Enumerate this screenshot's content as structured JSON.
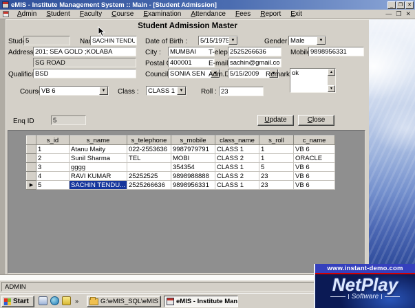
{
  "window": {
    "title": "eMIS - Institute Management System :: Main - [Student Admission]",
    "controls": {
      "minimize": "_",
      "restore": "❐",
      "close": "✕"
    },
    "mdi_controls": {
      "minimize": "—",
      "restore": "❐",
      "close": "✕"
    }
  },
  "menu": {
    "items": [
      "Admin",
      "Student",
      "Faculty",
      "Course",
      "Examination",
      "Attendance",
      "Fees",
      "Report",
      "Exit"
    ]
  },
  "form": {
    "header": "Student Admission Master",
    "fields": {
      "student_id": {
        "label": "Student ID :",
        "value": "5"
      },
      "name": {
        "label": "Name :",
        "value": "SACHIN TENDULKAR"
      },
      "dob": {
        "label": "Date of Birth :",
        "value": "5/15/1975"
      },
      "gender": {
        "label": "Gender :",
        "value": "Male"
      },
      "address": {
        "label": "Address",
        "value": "201; SEA GOLD ;KOLABA"
      },
      "address2": {
        "value": "SG ROAD"
      },
      "city": {
        "label": "City :",
        "value": "MUMBAI"
      },
      "telephone": {
        "label": "T-elephone :",
        "value": "2525266636"
      },
      "mobile": {
        "label": "Mobile :",
        "value": "9898956331"
      },
      "postal_code": {
        "label": "Postal Code :",
        "value": "400001"
      },
      "email": {
        "label": "E-mail ID :",
        "value": "sachin@gmail.com"
      },
      "qualification": {
        "label": "Qualification :",
        "value": "BSD"
      },
      "councillor": {
        "label": "Councillor :",
        "value": "SONIA SEN"
      },
      "adm_date": {
        "label": "Adm.Date :",
        "value": "5/15/2009"
      },
      "remarks": {
        "label": "Remarks :",
        "value": "ok"
      },
      "course": {
        "label": "Course :",
        "value": "VB 6"
      },
      "class": {
        "label": "Class :",
        "value": "CLASS 1"
      },
      "roll": {
        "label": "Roll :",
        "value": "23"
      },
      "enq_id": {
        "label": "Enq ID",
        "value": "5"
      }
    },
    "buttons": {
      "update": "Update",
      "close": "Close"
    }
  },
  "grid": {
    "columns": [
      "s_id",
      "s_name",
      "s_telephone",
      "s_mobile",
      "class_name",
      "s_roll",
      "c_name"
    ],
    "rows": [
      [
        "1",
        "Atanu Maity",
        "022-2553636",
        "9987979791",
        "CLASS 1",
        "1",
        "VB 6"
      ],
      [
        "2",
        "Sunil Sharma",
        "TEL",
        "MOBI",
        "CLASS 2",
        "1",
        "ORACLE"
      ],
      [
        "3",
        "gggg",
        "",
        "354354",
        "CLASS 1",
        "5",
        "VB 6"
      ],
      [
        "4",
        "RAVI KUMAR",
        "25252525",
        "9898988888",
        "CLASS 2",
        "23",
        "VB 6"
      ],
      [
        "5",
        "SACHIN TENDU...",
        "2525266636",
        "9898956331",
        "CLASS 1",
        "23",
        "VB 6"
      ]
    ],
    "selected_row_index": 4,
    "selected_cell": {
      "row": 4,
      "col": 1
    },
    "row_selector_glyph": "▶"
  },
  "status_bar": {
    "text": "ADMIN"
  },
  "taskbar": {
    "start_label": "Start",
    "quick_launch_overflow": "»",
    "items": [
      {
        "icon": "folder",
        "label": "G:\\eMIS_SQL\\eMIS _Sou...",
        "active": false
      },
      {
        "icon": "app",
        "label": "eMIS - Institute Man...",
        "active": true
      }
    ]
  },
  "watermark": {
    "url": "www.instant-demo.com",
    "brand": "NetPlay",
    "subtitle": "Software"
  },
  "colors": {
    "titlebar_blue": "#30519b",
    "chrome_gray": "#d4d0c8",
    "selection_blue": "#16369c",
    "netplay_bar_blue": "#3540bd",
    "netplay_red": "#d40000",
    "grid_panel_gray": "#8f8f8f"
  }
}
